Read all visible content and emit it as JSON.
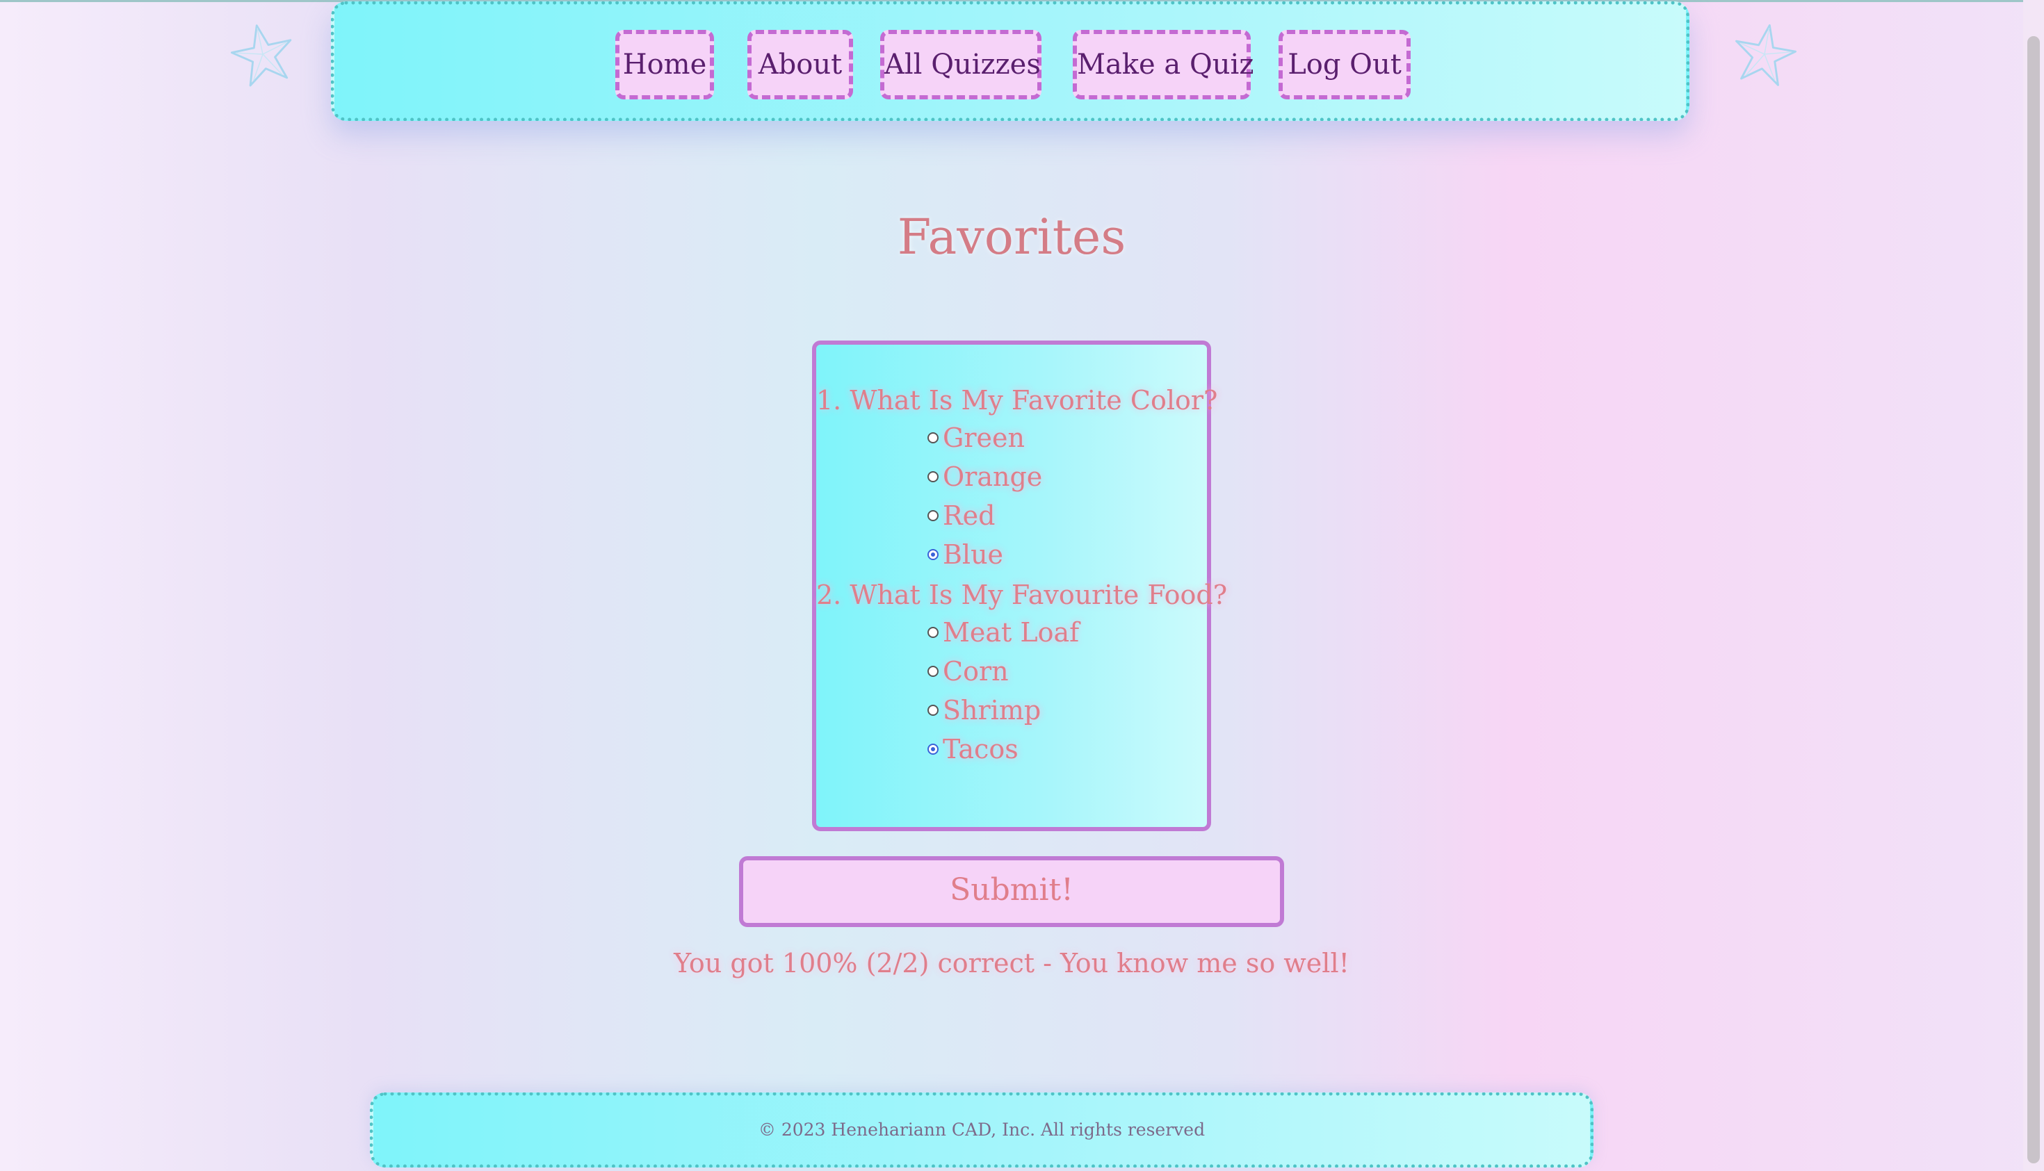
{
  "nav": {
    "items": [
      {
        "label": "Home"
      },
      {
        "label": "About"
      },
      {
        "label": "All Quizzes"
      },
      {
        "label": "Make a Quiz"
      },
      {
        "label": "Log Out"
      }
    ]
  },
  "page": {
    "title": "Favorites"
  },
  "quiz": {
    "questions": [
      {
        "label": "1. What Is My Favorite Color?",
        "options": [
          {
            "label": "Green",
            "checked": false
          },
          {
            "label": "Orange",
            "checked": false
          },
          {
            "label": "Red",
            "checked": false
          },
          {
            "label": "Blue",
            "checked": true
          }
        ]
      },
      {
        "label": "2. What Is My Favourite Food?",
        "options": [
          {
            "label": "Meat Loaf",
            "checked": false
          },
          {
            "label": "Corn",
            "checked": false
          },
          {
            "label": "Shrimp",
            "checked": false
          },
          {
            "label": "Tacos",
            "checked": true
          }
        ]
      }
    ],
    "submit_label": "Submit!",
    "result_text": "You got 100% (2/2) correct - You know me so well!"
  },
  "footer": {
    "copyright": "© 2023 Henehariann CAD, Inc. All rights reserved"
  },
  "icons": {
    "decor_left": "star-outline-icon",
    "decor_right": "star-outline-icon"
  },
  "colors": {
    "nav_bg": "#7ff4fa",
    "nav_item_bg": "#f6d3f8",
    "nav_item_border": "#c46ad2",
    "accent_text": "#e07e8b",
    "card_border": "#c07ad4",
    "radio_checked": "#3a63d8"
  }
}
